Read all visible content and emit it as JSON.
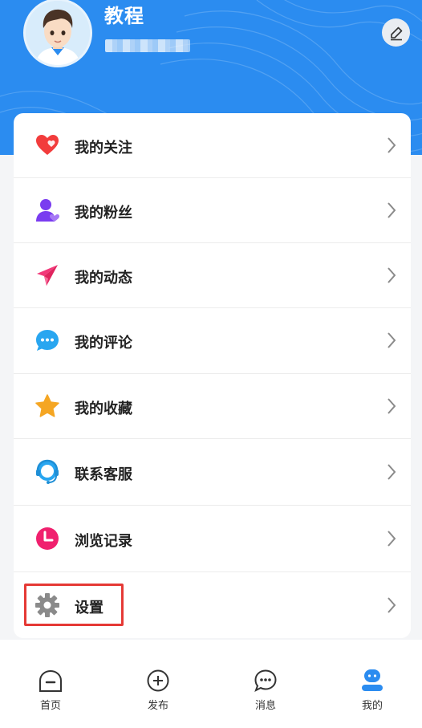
{
  "profile": {
    "username": "教程",
    "user_id_masked": "",
    "avatar": "boy-avatar"
  },
  "header": {
    "background_color": "#2b8cf0",
    "edit_icon": "pencil-icon"
  },
  "menu": {
    "items": [
      {
        "label": "我的关注",
        "icon": "heart-icon",
        "icon_color": "#f23c3c"
      },
      {
        "label": "我的粉丝",
        "icon": "user-heart-icon",
        "icon_color": "#7a3cf0"
      },
      {
        "label": "我的动态",
        "icon": "paper-plane-icon",
        "icon_color": "#f2397a"
      },
      {
        "label": "我的评论",
        "icon": "chat-bubble-icon",
        "icon_color": "#29a6f0"
      },
      {
        "label": "我的收藏",
        "icon": "star-icon",
        "icon_color": "#f5a623"
      },
      {
        "label": "联系客服",
        "icon": "headset-icon",
        "icon_color": "#29a6f0"
      },
      {
        "label": "浏览记录",
        "icon": "clock-icon",
        "icon_color": "#f0206e"
      },
      {
        "label": "设置",
        "icon": "gear-icon",
        "icon_color": "#8a8a8a"
      }
    ],
    "highlighted_item": "设置",
    "highlight_color": "#e53935"
  },
  "tabbar": {
    "tabs": [
      {
        "label": "首页",
        "icon": "home-icon",
        "active": false
      },
      {
        "label": "发布",
        "icon": "plus-circle-icon",
        "active": false
      },
      {
        "label": "消息",
        "icon": "message-icon",
        "active": false
      },
      {
        "label": "我的",
        "icon": "profile-icon",
        "active": true
      }
    ],
    "active_color": "#2b8cf0"
  }
}
